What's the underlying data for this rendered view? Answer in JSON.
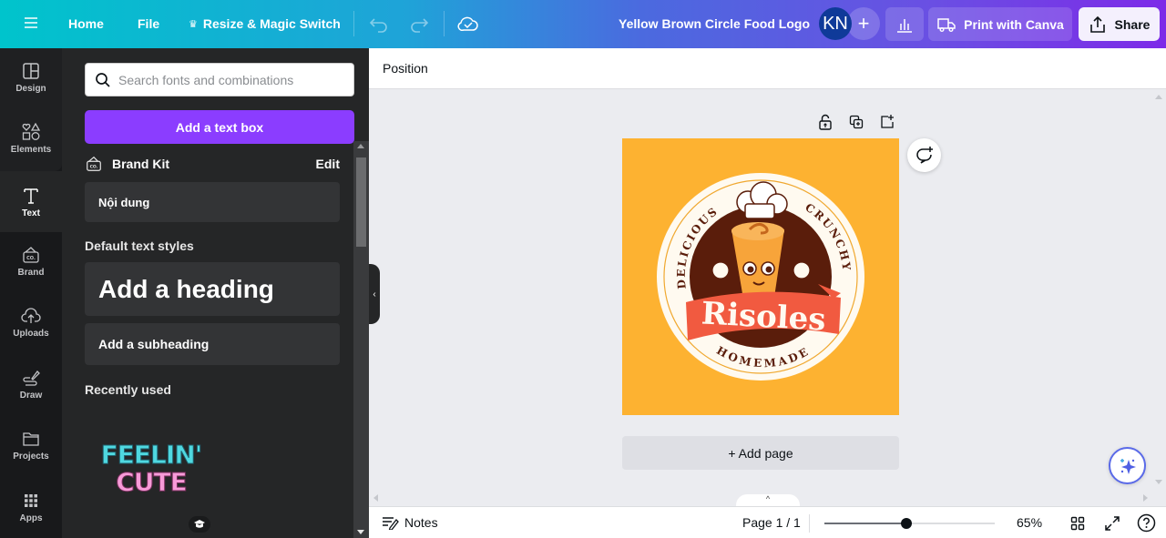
{
  "topbar": {
    "menu_icon": "hamburger-icon",
    "home": "Home",
    "file": "File",
    "resize": "Resize & Magic Switch",
    "undo_icon": "undo-icon",
    "redo_icon": "redo-icon",
    "save_status_icon": "cloud-check-icon",
    "doc_title": "Yellow Brown Circle Food Logo",
    "avatar_initials": "KN",
    "add_collaborator": "+",
    "insights_icon": "bar-chart-icon",
    "print": "Print with Canva",
    "share": "Share"
  },
  "rail": {
    "items": [
      {
        "label": "Design",
        "icon": "layout-icon"
      },
      {
        "label": "Elements",
        "icon": "shapes-icon"
      },
      {
        "label": "Text",
        "icon": "text-icon",
        "active": true
      },
      {
        "label": "Brand",
        "icon": "brand-icon"
      },
      {
        "label": "Uploads",
        "icon": "upload-cloud-icon"
      },
      {
        "label": "Draw",
        "icon": "draw-icon"
      },
      {
        "label": "Projects",
        "icon": "folder-icon"
      },
      {
        "label": "Apps",
        "icon": "apps-grid-icon"
      }
    ]
  },
  "panel": {
    "search_placeholder": "Search fonts and combinations",
    "search_value": "",
    "add_textbox": "Add a text box",
    "brand_kit": "Brand Kit",
    "brand_kit_edit": "Edit",
    "brand_content": "Nội dung",
    "default_styles_label": "Default text styles",
    "heading": "Add a heading",
    "subheading": "Add a subheading",
    "recently_used_label": "Recently used",
    "recent_item_line1": "FEELIN'",
    "recent_item_line2": "CUTE"
  },
  "canvas": {
    "position_label": "Position",
    "add_page": "+ Add page",
    "design": {
      "top_left_arc": "DELICIOUS",
      "top_right_arc": "CRUNCHY",
      "banner": "Risoles",
      "bottom_arc": "HOMEMADE",
      "background_color": "#fdb231",
      "dark_color": "#5a1d0b",
      "banner_color": "#f15a40"
    }
  },
  "bottombar": {
    "notes": "Notes",
    "page_indicator": "Page 1 / 1",
    "zoom_percent": 65,
    "zoom_label": "65%",
    "zoom_slider_fraction": 0.48
  },
  "colors": {
    "accent_purple": "#8b3dff",
    "panel_bg": "#252627",
    "rail_bg": "#18191b"
  }
}
